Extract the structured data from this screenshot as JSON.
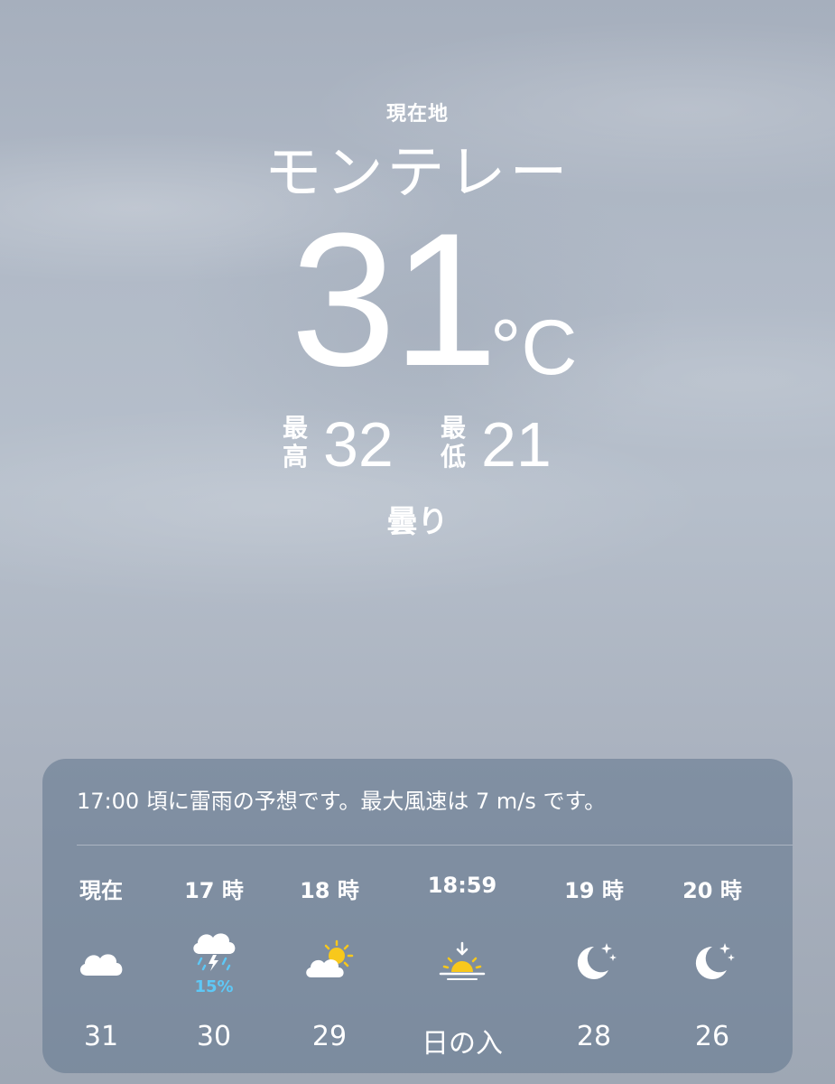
{
  "location": {
    "label": "現在地",
    "city": "モンテレー"
  },
  "current": {
    "temperature": "31",
    "unit": "°C",
    "high_label": "最高",
    "high": "32",
    "low_label": "最低",
    "low": "21",
    "condition": "曇り"
  },
  "forecast_card": {
    "summary": "17:00 頃に雷雨の予想です。最大風速は 7 m/s です。",
    "hours": [
      {
        "time": "現在",
        "icon": "cloud-icon",
        "temp": "31",
        "pop": ""
      },
      {
        "time": "17 時",
        "icon": "thunderstorm-icon",
        "temp": "30",
        "pop": "15%"
      },
      {
        "time": "18 時",
        "icon": "partly-sunny-icon",
        "temp": "29",
        "pop": ""
      },
      {
        "time": "18:59",
        "icon": "sunset-icon",
        "temp": "日の入",
        "pop": ""
      },
      {
        "time": "19 時",
        "icon": "moon-stars-icon",
        "temp": "28",
        "pop": ""
      },
      {
        "time": "20 時",
        "icon": "moon-stars-icon",
        "temp": "26",
        "pop": ""
      }
    ]
  },
  "colors": {
    "precipitation": "#5ec8f6",
    "sun": "#f8c81c"
  }
}
